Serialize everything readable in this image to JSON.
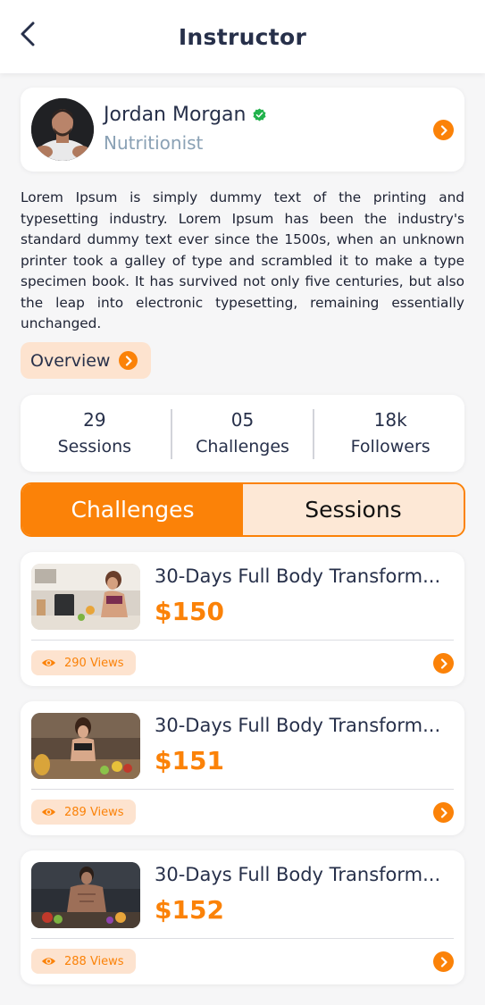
{
  "header": {
    "title": "Instructor",
    "back_icon": "chevron-left-icon"
  },
  "profile": {
    "name": "Jordan Morgan",
    "role": "Nutritionist",
    "verified": true,
    "verified_color": "#22b24c"
  },
  "bio": "Lorem Ipsum is simply dummy text of the printing and typesetting industry. Lorem Ipsum has been the industry's standard dummy text ever since the 1500s, when an unknown printer took a galley of type and scrambled it to make a type specimen book. It has survived not only five centuries, but also the leap into electronic typesetting, remaining essentially unchanged.",
  "overview_button": {
    "label": "Overview"
  },
  "stats": [
    {
      "value": "29",
      "label": "Sessions"
    },
    {
      "value": "05",
      "label": "Challenges"
    },
    {
      "value": "18k",
      "label": "Followers"
    }
  ],
  "tabs": [
    {
      "label": "Challenges",
      "active": true
    },
    {
      "label": "Sessions",
      "active": false
    }
  ],
  "items": [
    {
      "title": "30-Days Full Body Transform...",
      "price": "$150",
      "views": "290 Views"
    },
    {
      "title": "30-Days Full Body Transform...",
      "price": "$151",
      "views": "289 Views"
    },
    {
      "title": "30-Days Full Body Transform...",
      "price": "$152",
      "views": "288 Views"
    }
  ],
  "colors": {
    "accent": "#fb8208",
    "accent_light": "#fde3cf",
    "text_dark": "#27304a",
    "text_muted": "#8aa1b5"
  }
}
